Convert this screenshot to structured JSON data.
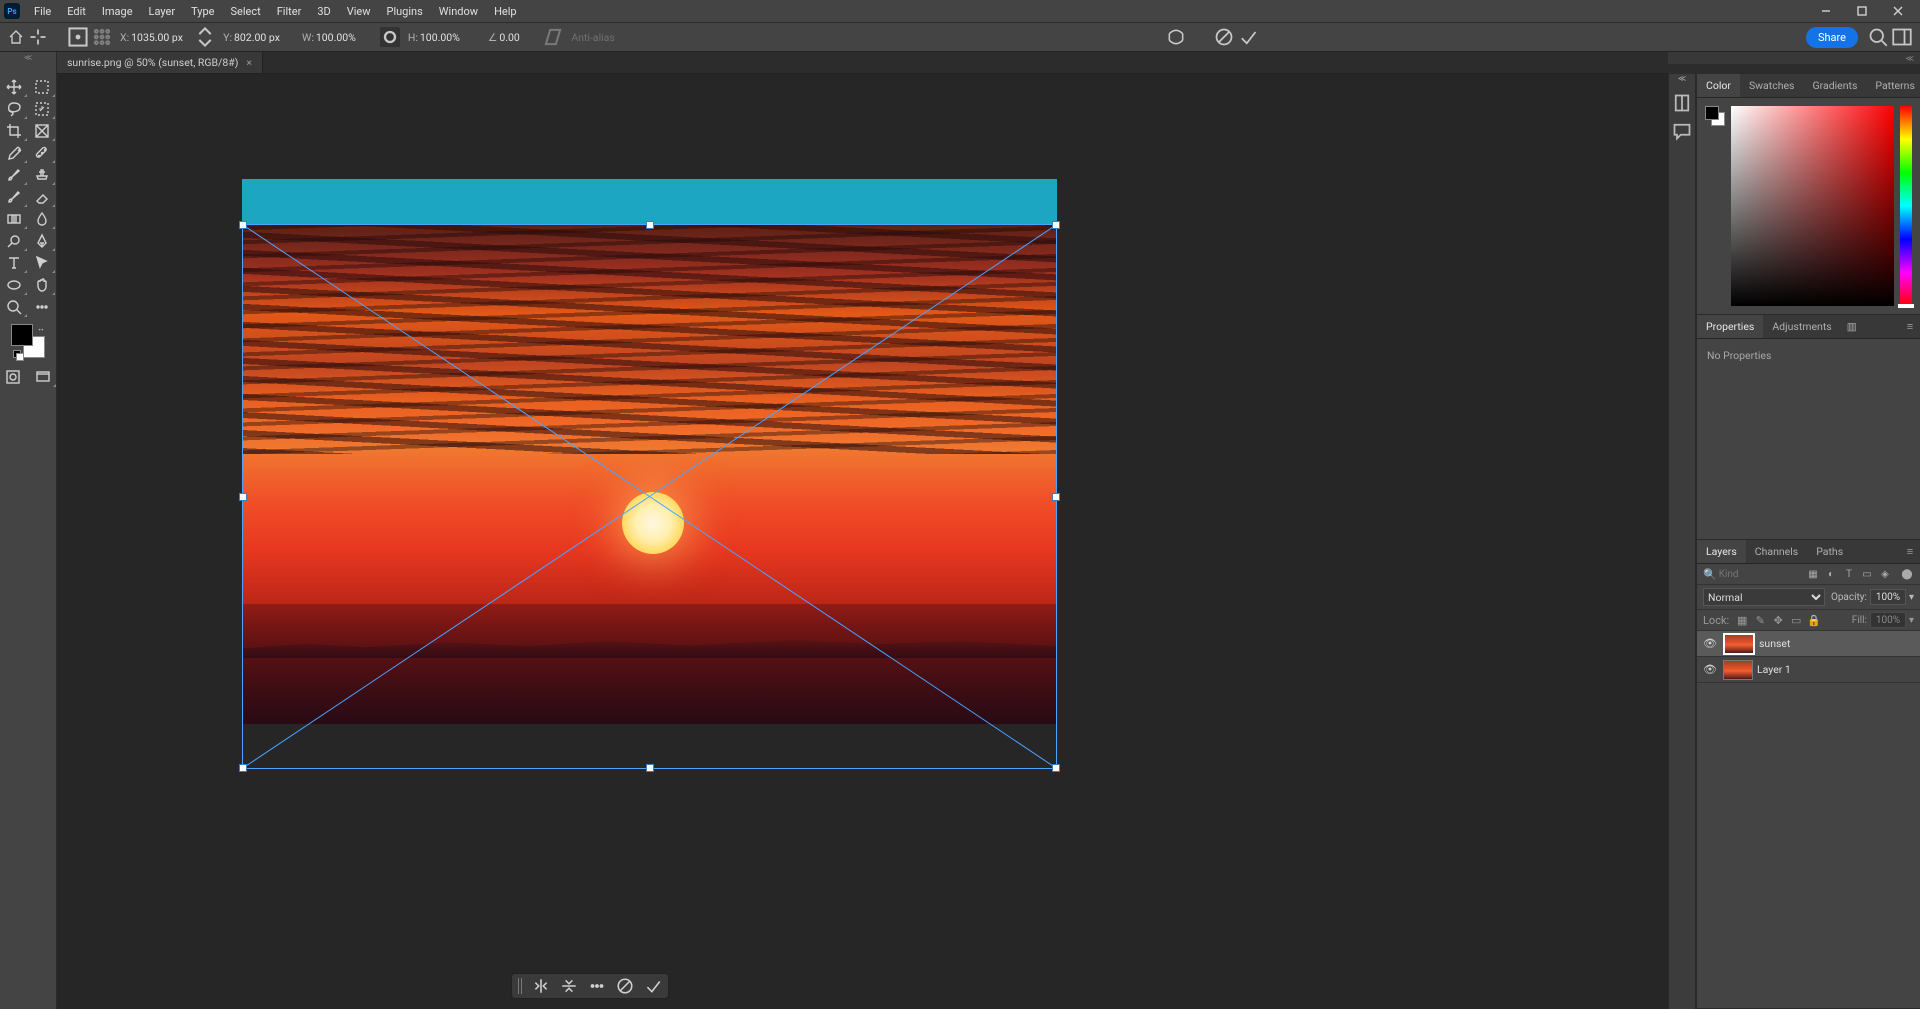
{
  "menu": {
    "items": [
      "File",
      "Edit",
      "Image",
      "Layer",
      "Type",
      "Select",
      "Filter",
      "3D",
      "View",
      "Plugins",
      "Window",
      "Help"
    ]
  },
  "options": {
    "x_label": "X:",
    "x_value": "1035.00 px",
    "y_label": "Y:",
    "y_value": "802.00 px",
    "w_label": "W:",
    "w_value": "100.00%",
    "h_label": "H:",
    "h_value": "100.00%",
    "angle_label": "∠",
    "angle_value": "0.00",
    "antialias": "Anti-alias",
    "share": "Share"
  },
  "document": {
    "tab_title": "sunrise.png @ 50% (sunset, RGB/8#)"
  },
  "panels": {
    "color": {
      "tabs": [
        "Color",
        "Swatches",
        "Gradients",
        "Patterns"
      ]
    },
    "props": {
      "tabs": [
        "Properties",
        "Adjustments"
      ],
      "no_props": "No Properties"
    },
    "layers": {
      "tabs": [
        "Layers",
        "Channels",
        "Paths"
      ],
      "filter_placeholder": "Kind",
      "blend_mode": "Normal",
      "opacity_label": "Opacity:",
      "opacity_value": "100%",
      "lock_label": "Lock:",
      "fill_label": "Fill:",
      "fill_value": "100%",
      "items": [
        {
          "name": "sunset",
          "visible": true,
          "active": true
        },
        {
          "name": "Layer 1",
          "visible": true,
          "active": false
        }
      ]
    }
  }
}
